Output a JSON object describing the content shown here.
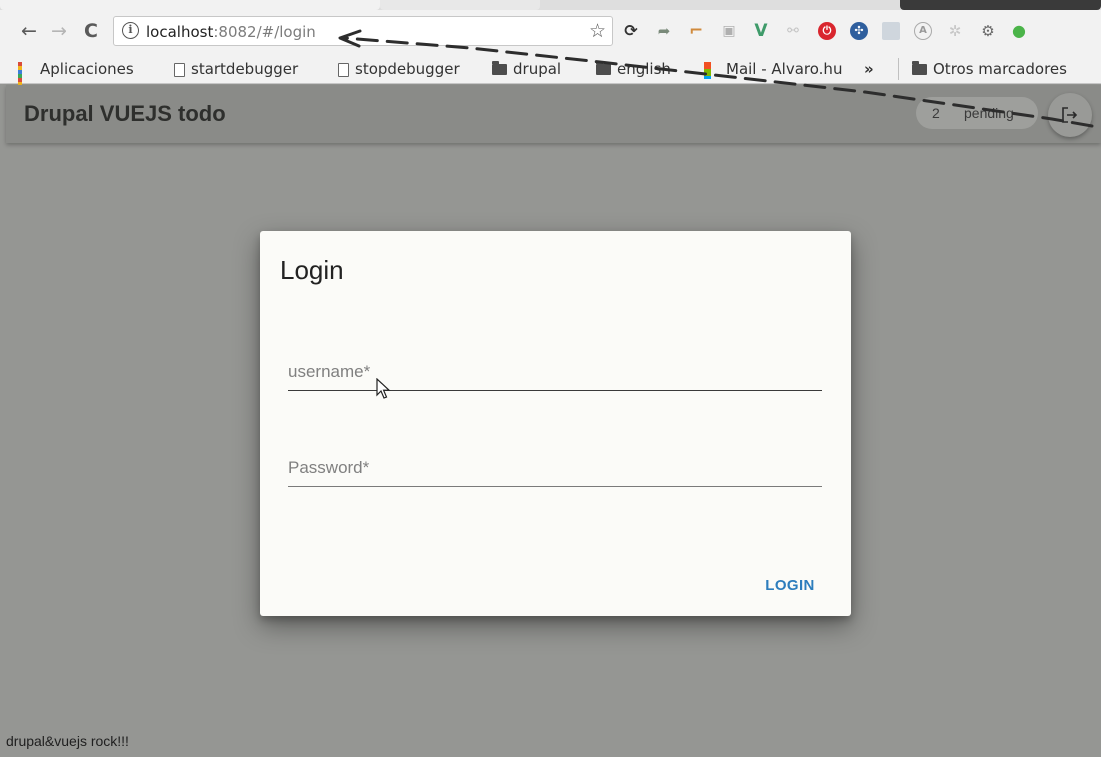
{
  "browser": {
    "url_host": "localhost",
    "url_rest": ":8082/#/login",
    "bookmarks": {
      "apps": "Aplicaciones",
      "start": "startdebugger",
      "stop": "stopdebugger",
      "drupal": "drupal",
      "english": "english",
      "mail": "Mail - Alvaro.hu",
      "more": "»",
      "other": "Otros marcadores"
    }
  },
  "app": {
    "title": "Drupal VUEJS todo",
    "pending_count": "2",
    "pending_label": "pending"
  },
  "dialog": {
    "title": "Login",
    "username_placeholder": "username*",
    "password_placeholder": "Password*",
    "login_button": "LOGIN"
  },
  "footer": {
    "text": "drupal&vuejs rock!!!"
  },
  "colors": {
    "overlay": "#959693",
    "dialog_bg": "#fbfbf8",
    "accent": "#2d7dbd"
  }
}
